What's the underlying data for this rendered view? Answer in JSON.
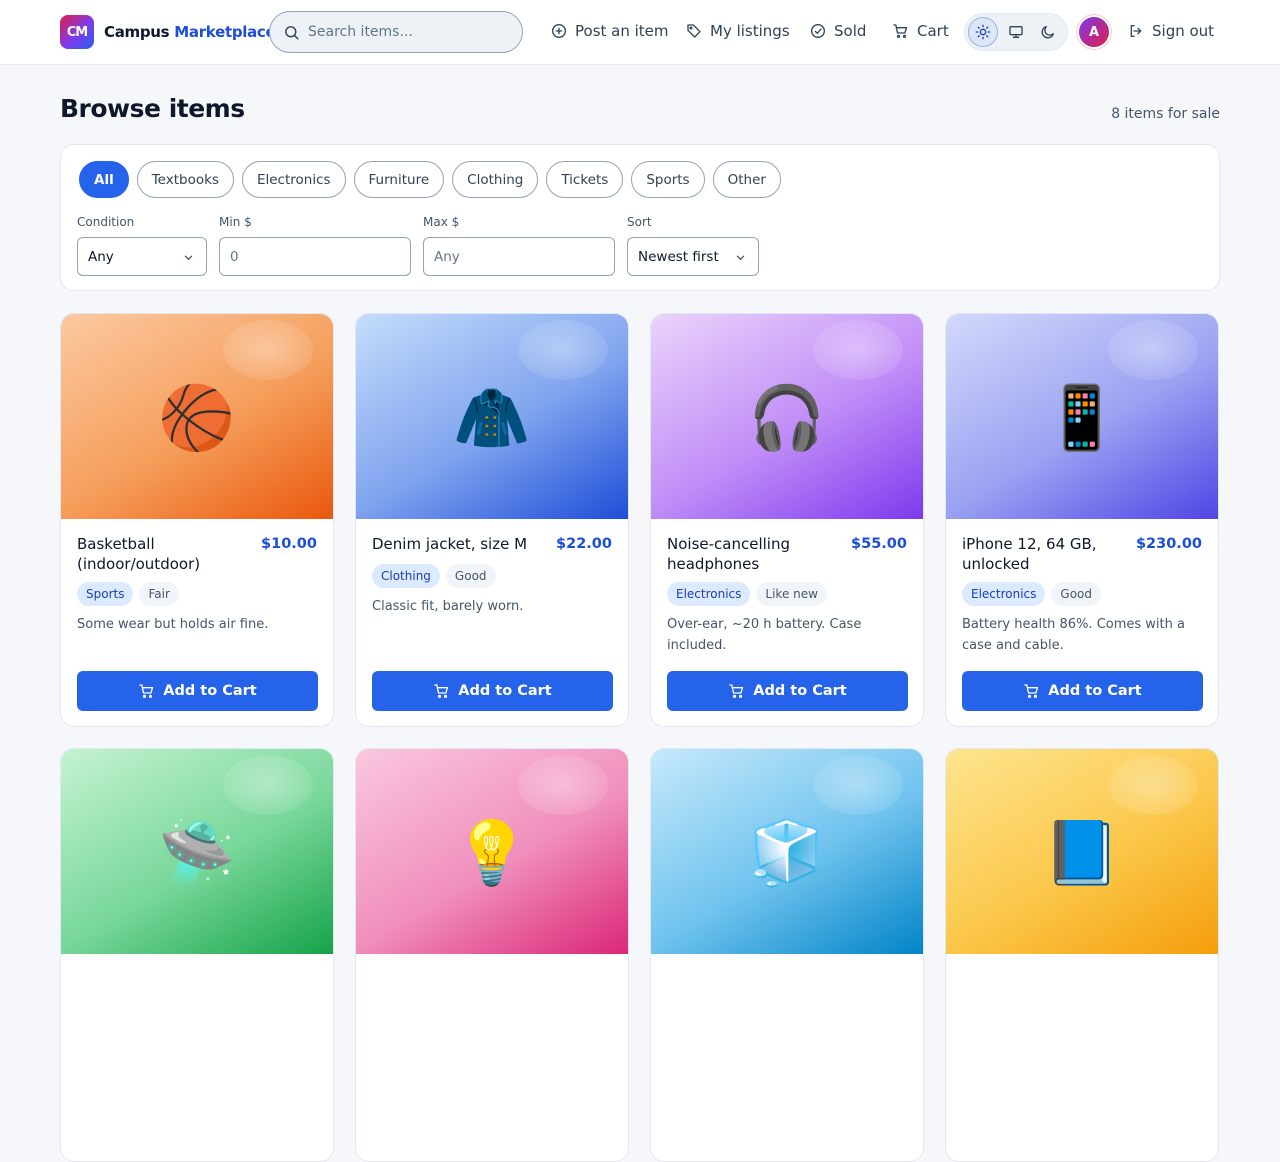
{
  "header": {
    "logo_text": "CM",
    "brand_primary": "Campus",
    "brand_accent": "Marketplace",
    "search_placeholder": "Search items...",
    "nav": {
      "post": "Post an item",
      "listings": "My listings",
      "sold": "Sold",
      "cart": "Cart",
      "signout": "Sign out"
    },
    "theme_selected": "light",
    "avatar_initial": "A"
  },
  "page": {
    "title": "Browse items",
    "count": "8 items for sale"
  },
  "filters": {
    "categories": [
      "All",
      "Textbooks",
      "Electronics",
      "Furniture",
      "Clothing",
      "Tickets",
      "Sports",
      "Other"
    ],
    "active_category": "All",
    "condition": {
      "label": "Condition",
      "value": "Any"
    },
    "min": {
      "label": "Min $",
      "placeholder": "0"
    },
    "max": {
      "label": "Max $",
      "placeholder": "Any"
    },
    "sort": {
      "label": "Sort",
      "value": "Newest first"
    }
  },
  "add_to_cart_label": "Add to Cart",
  "items": [
    {
      "title": "Basketball (indoor/outdoor)",
      "price": "$10.00",
      "category": "Sports",
      "condition": "Fair",
      "desc": "Some wear but holds air fine.",
      "emoji": "🏀",
      "colors": [
        "#fcc9a1",
        "#f59e5b",
        "#ea580c"
      ]
    },
    {
      "title": "Denim jacket, size M",
      "price": "$22.00",
      "category": "Clothing",
      "condition": "Good",
      "desc": "Classic fit, barely worn.",
      "emoji": "🧥",
      "colors": [
        "#c5dcfb",
        "#7fa3ee",
        "#1d4ed8"
      ]
    },
    {
      "title": "Noise-cancelling headphones",
      "price": "$55.00",
      "category": "Electronics",
      "condition": "Like new",
      "desc": "Over-ear, ~20 h battery. Case included.",
      "emoji": "🎧",
      "colors": [
        "#ead4fb",
        "#c08cf7",
        "#7c3aed"
      ]
    },
    {
      "title": "iPhone 12, 64 GB, unlocked",
      "price": "$230.00",
      "category": "Electronics",
      "condition": "Good",
      "desc": "Battery health 86%. Comes with a case and cable.",
      "emoji": "📱",
      "colors": [
        "#d2d9fb",
        "#9aa2f2",
        "#4f46e5"
      ]
    },
    {
      "title": "",
      "price": "",
      "category": "",
      "condition": "",
      "desc": "",
      "emoji": "🛸",
      "colors": [
        "#c5f3d1",
        "#78d79a",
        "#16a34a"
      ]
    },
    {
      "title": "",
      "price": "",
      "category": "",
      "condition": "",
      "desc": "",
      "emoji": "💡",
      "colors": [
        "#fac7df",
        "#f08fbc",
        "#db2777"
      ]
    },
    {
      "title": "",
      "price": "",
      "category": "",
      "condition": "",
      "desc": "",
      "emoji": "🧊",
      "colors": [
        "#c6e9fb",
        "#6fc3ee",
        "#0284c7"
      ]
    },
    {
      "title": "",
      "price": "",
      "category": "",
      "condition": "",
      "desc": "",
      "emoji": "📘",
      "colors": [
        "#fde58f",
        "#fbc74a",
        "#f59e0b"
      ]
    }
  ]
}
